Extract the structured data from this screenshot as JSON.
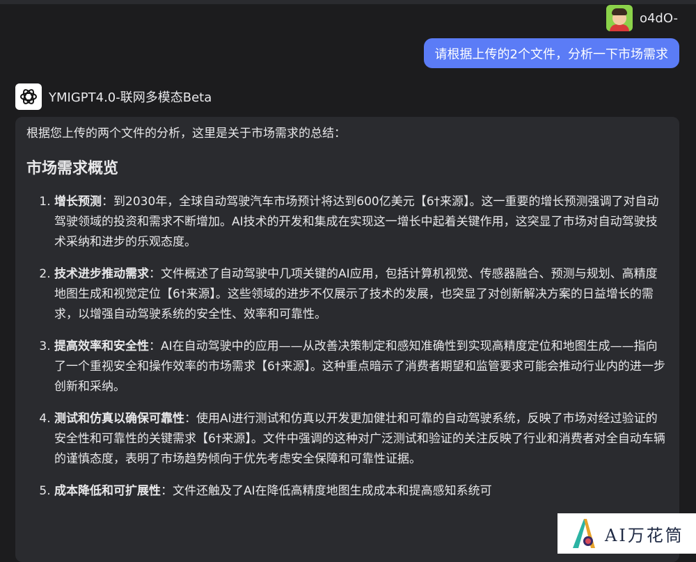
{
  "user": {
    "name": "o4dO-"
  },
  "user_message": "请根据上传的2个文件，分析一下市场需求",
  "bot": {
    "name": "YMIGPT4.0-联网多模态Beta"
  },
  "answer": {
    "intro": "根据您上传的两个文件的分析，这里是关于市场需求的总结：",
    "section_title": "市场需求概览",
    "items": [
      {
        "title": "增长预测",
        "text": "：到2030年，全球自动驾驶汽车市场预计将达到600亿美元【6†来源】。这一重要的增长预测强调了对自动驾驶领域的投资和需求不断增加。AI技术的开发和集成在实现这一增长中起着关键作用，这突显了市场对自动驾驶技术采纳和进步的乐观态度。"
      },
      {
        "title": "技术进步推动需求",
        "text": "：文件概述了自动驾驶中几项关键的AI应用，包括计算机视觉、传感器融合、预测与规划、高精度地图生成和视觉定位【6†来源】。这些领域的进步不仅展示了技术的发展，也突显了对创新解决方案的日益增长的需求，以增强自动驾驶系统的安全性、效率和可靠性。"
      },
      {
        "title": "提高效率和安全性",
        "text": "：AI在自动驾驶中的应用——从改善决策制定和感知准确性到实现高精度定位和地图生成——指向了一个重视安全和操作效率的市场需求【6†来源】。这种重点暗示了消费者期望和监管要求可能会推动行业内的进一步创新和采纳。"
      },
      {
        "title": "测试和仿真以确保可靠性",
        "text": "：使用AI进行测试和仿真以开发更加健壮和可靠的自动驾驶系统，反映了市场对经过验证的安全性和可靠性的关键需求【6†来源】。文件中强调的这种对广泛测试和验证的关注反映了行业和消费者对全自动车辆的谨慎态度，表明了市场趋势倾向于优先考虑安全保障和可靠性证据。"
      },
      {
        "title": "成本降低和可扩展性",
        "text": "：文件还触及了AI在降低高精度地图生成成本和提高感知系统可"
      }
    ]
  },
  "watermark": {
    "text": "AI万花筒"
  },
  "colors": {
    "background": "#1c1c1e",
    "panel": "#2a2b2f",
    "user_bubble": "#5b7cf6",
    "text": "#e8e8ea"
  }
}
